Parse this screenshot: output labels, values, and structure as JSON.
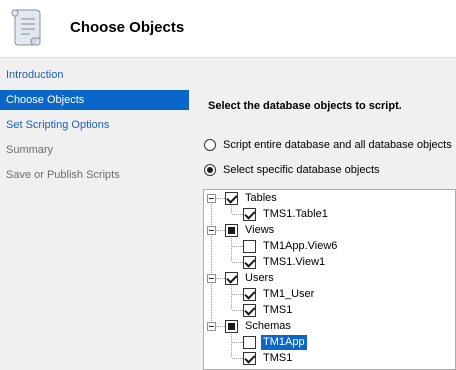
{
  "header": {
    "title": "Choose Objects",
    "icon": "script-scroll-icon"
  },
  "sidebar": {
    "items": [
      {
        "label": "Introduction",
        "state": "link"
      },
      {
        "label": "Choose Objects",
        "state": "selected"
      },
      {
        "label": "Set Scripting Options",
        "state": "link"
      },
      {
        "label": "Summary",
        "state": "disabled"
      },
      {
        "label": "Save or Publish Scripts",
        "state": "disabled"
      }
    ]
  },
  "main": {
    "instruction": "Select the database objects to script.",
    "options": [
      {
        "label": "Script entire database and all database objects",
        "checked": false
      },
      {
        "label": "Select specific database objects",
        "checked": true
      }
    ]
  },
  "tree": {
    "groups": [
      {
        "label": "Tables",
        "check": "checked",
        "children": [
          {
            "label": "TMS1.Table1",
            "check": "checked"
          }
        ]
      },
      {
        "label": "Views",
        "check": "partial",
        "children": [
          {
            "label": "TM1App.View6",
            "check": "unchecked"
          },
          {
            "label": "TMS1.View1",
            "check": "checked"
          }
        ]
      },
      {
        "label": "Users",
        "check": "checked",
        "children": [
          {
            "label": "TM1_User",
            "check": "checked"
          },
          {
            "label": "TMS1",
            "check": "checked"
          }
        ]
      },
      {
        "label": "Schemas",
        "check": "partial",
        "children": [
          {
            "label": "TM1App",
            "check": "unchecked",
            "selected": true
          },
          {
            "label": "TMS1",
            "check": "checked"
          }
        ]
      }
    ]
  },
  "colors": {
    "accent": "#0a66c8",
    "link": "#1f5fb5",
    "panel_bg": "#f0f0f0"
  }
}
